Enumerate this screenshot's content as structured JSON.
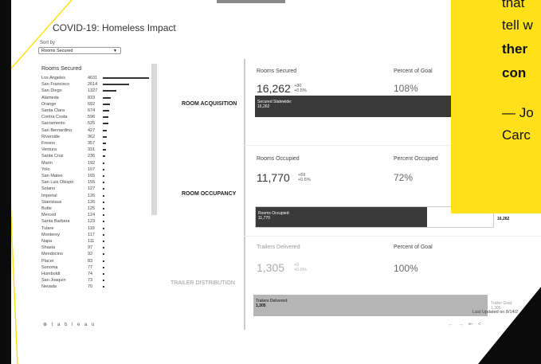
{
  "title": "COVID-19: Homeless Impact",
  "sort_by_label": "Sort by",
  "sort_value": "Rooms Secured",
  "list_title": "Rooms Secured",
  "counties": [
    {
      "name": "Los Angeles",
      "value": 4631
    },
    {
      "name": "San Francisco",
      "value": 2614
    },
    {
      "name": "San Diego",
      "value": 1327
    },
    {
      "name": "Alameda",
      "value": 833
    },
    {
      "name": "Orange",
      "value": 692
    },
    {
      "name": "Santa Clara",
      "value": 674
    },
    {
      "name": "Contra Costa",
      "value": 596
    },
    {
      "name": "Sacramento",
      "value": 525
    },
    {
      "name": "San Bernardino",
      "value": 427
    },
    {
      "name": "Riverside",
      "value": 362
    },
    {
      "name": "Fresno",
      "value": 357
    },
    {
      "name": "Ventura",
      "value": 331
    },
    {
      "name": "Santa Cruz",
      "value": 236
    },
    {
      "name": "Marin",
      "value": 192
    },
    {
      "name": "Yolo",
      "value": 167
    },
    {
      "name": "San Mateo",
      "value": 165
    },
    {
      "name": "San Luis Obispo",
      "value": 155
    },
    {
      "name": "Solano",
      "value": 127
    },
    {
      "name": "Imperial",
      "value": 126
    },
    {
      "name": "Stanislaus",
      "value": 126
    },
    {
      "name": "Butte",
      "value": 125
    },
    {
      "name": "Merced",
      "value": 124
    },
    {
      "name": "Santa Barbara",
      "value": 123
    },
    {
      "name": "Tulare",
      "value": 119
    },
    {
      "name": "Monterey",
      "value": 117
    },
    {
      "name": "Napa",
      "value": 111
    },
    {
      "name": "Shasta",
      "value": 97
    },
    {
      "name": "Mendocino",
      "value": 92
    },
    {
      "name": "Placer",
      "value": 83
    },
    {
      "name": "Sonoma",
      "value": 77
    },
    {
      "name": "Humboldt",
      "value": 74
    },
    {
      "name": "San Joaquin",
      "value": 73
    },
    {
      "name": "Nevada",
      "value": 70
    }
  ],
  "sections": {
    "acquisition": {
      "label": "ROOM ACQUISITION",
      "kpi_label": "Rooms Secured",
      "kpi_value": "16,262",
      "delta_abs": "+80",
      "delta_pct": "+0.5%",
      "pct_label": "Percent of Goal",
      "pct_value": "108%",
      "bar_title": "Secured Statewide:",
      "bar_value": "16,262",
      "bar_fraction": 1.0
    },
    "occupancy": {
      "label": "ROOM OCCUPANCY",
      "kpi_label": "Rooms Occupied",
      "kpi_value": "11,770",
      "delta_abs": "+69",
      "delta_pct": "+0.6%",
      "pct_label": "Percent Occupied",
      "pct_value": "72%",
      "bar_title": "Rooms Occupied:",
      "bar_value": "11,770",
      "bar_end": "16,262",
      "bar_fraction": 0.72
    },
    "trailers": {
      "label": "TRAILER DISTRIBUTION",
      "kpi_label": "Trailers Delivered",
      "kpi_value": "1,305",
      "delta_abs": "+0",
      "delta_pct": "+0.0%",
      "pct_label": "Percent of Goal",
      "pct_value": "100%",
      "bar_title": "Trailers Delivered:",
      "bar_value": "1,305",
      "goal_title": "Trailer Goal:",
      "goal_value": "1,305",
      "bar_fraction": 1.0
    }
  },
  "last_updated": "Last Updated on 8/14/2",
  "tableau_logo": "⊕ t a b l e a u",
  "quote_lines": [
    "that",
    "tell w",
    "ther",
    "con",
    "— Jo",
    "Carc"
  ],
  "colors": {
    "accent_yellow": "#ffe01a",
    "bar_dark": "#3a3a3a",
    "bar_gray": "#b5b5b5"
  }
}
